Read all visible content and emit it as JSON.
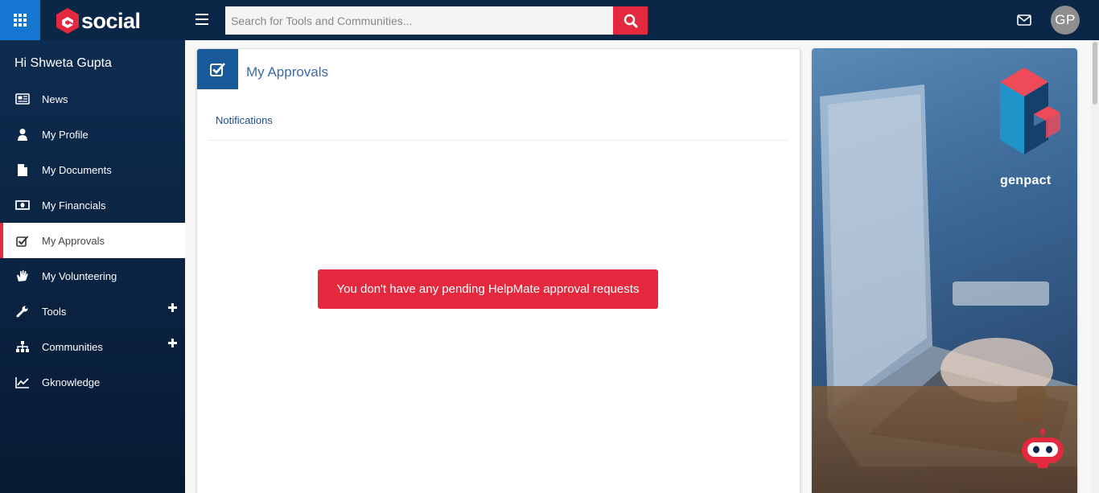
{
  "brand": {
    "name": "social",
    "accent": "#e4293f",
    "primary": "#0b2747"
  },
  "search": {
    "placeholder": "Search for Tools and Communities..."
  },
  "user": {
    "initials": "GP"
  },
  "sidebar": {
    "greeting": "Hi Shweta Gupta",
    "items": [
      {
        "label": "News",
        "icon": "newspaper-icon"
      },
      {
        "label": "My Profile",
        "icon": "user-icon"
      },
      {
        "label": "My Documents",
        "icon": "document-icon"
      },
      {
        "label": "My Financials",
        "icon": "money-icon"
      },
      {
        "label": "My Approvals",
        "icon": "checkbox-icon",
        "active": true
      },
      {
        "label": "My Volunteering",
        "icon": "hand-icon"
      },
      {
        "label": "Tools",
        "icon": "wrench-icon",
        "expandable": true
      },
      {
        "label": "Communities",
        "icon": "org-chart-icon",
        "expandable": true
      },
      {
        "label": "Gknowledge",
        "icon": "line-chart-icon"
      }
    ]
  },
  "main": {
    "title": "My Approvals",
    "tabs": [
      {
        "label": "Notifications"
      }
    ],
    "alert": "You don't have any pending HelpMate approval requests"
  },
  "banner": {
    "brand_text": "genpact"
  }
}
